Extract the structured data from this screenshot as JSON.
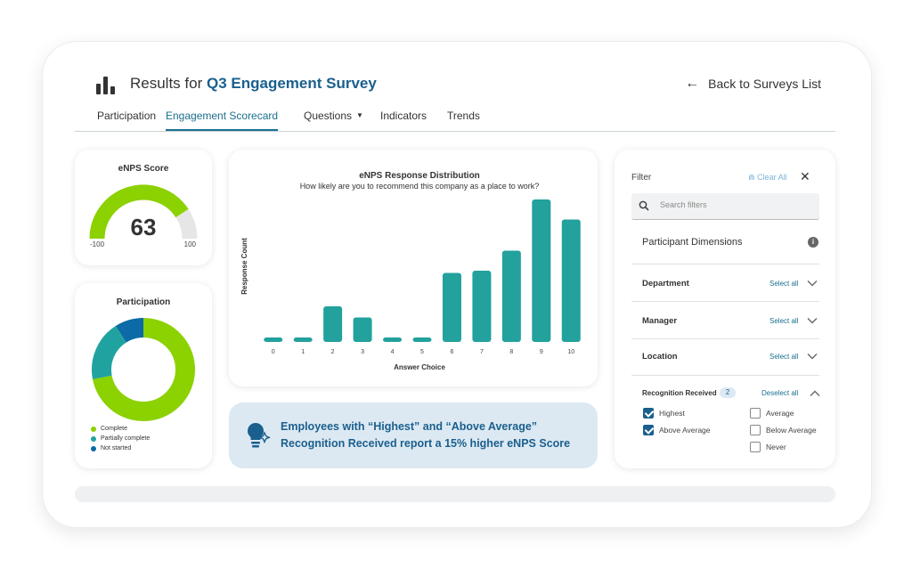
{
  "header": {
    "title_prefix": "Results for",
    "survey_name": "Q3 Engagement Survey",
    "back_label": "Back to Surveys List"
  },
  "tabs": [
    {
      "label": "Participation",
      "active": false
    },
    {
      "label": "Engagement Scorecard",
      "active": true
    },
    {
      "label": "Questions",
      "active": false
    },
    {
      "label": "Indicators",
      "active": false
    },
    {
      "label": "Trends",
      "active": false
    }
  ],
  "enps": {
    "title": "eNPS Score",
    "score": "63",
    "score_value": 63,
    "min_label": "-100",
    "max_label": "100",
    "min": -100,
    "max": 100,
    "fill_color": "#8cd100",
    "track_color": "#e6e6e6"
  },
  "participation": {
    "title": "Participation",
    "legend": [
      {
        "label": "Complete",
        "color": "#8cd100",
        "fraction": 0.72
      },
      {
        "label": "Partially complete",
        "color": "#20a3a0",
        "fraction": 0.19
      },
      {
        "label": "Not started",
        "color": "#0c6aa6",
        "fraction": 0.09
      }
    ]
  },
  "chart_data": {
    "type": "bar",
    "title": "eNPS Response Distribution",
    "subtitle": "How likely are you to recommend this company as a place to work?",
    "xlabel": "Answer Choice",
    "ylabel": "Response Count",
    "categories": [
      "0",
      "1",
      "2",
      "3",
      "4",
      "5",
      "6",
      "7",
      "8",
      "9",
      "10"
    ],
    "values": [
      1,
      1,
      8,
      5.5,
      1,
      1,
      15.5,
      16,
      20.5,
      32,
      27.5
    ],
    "ylim": [
      0,
      32
    ],
    "bar_color": "#22a19d",
    "grid": false
  },
  "insight": {
    "line1": "Employees with “Highest” and “Above Average”",
    "line2": "Recognition Received report a 15% higher eNPS Score",
    "icon": "lightbulb-sparkle-icon"
  },
  "filter": {
    "title": "Filter",
    "clear_label": "Clear All",
    "search_placeholder": "Search filters",
    "section_title": "Participant Dimensions",
    "dimensions": [
      {
        "label": "Department",
        "action": "Select all"
      },
      {
        "label": "Manager",
        "action": "Select all"
      },
      {
        "label": "Location",
        "action": "Select all"
      }
    ],
    "recognition": {
      "label": "Recognition Received",
      "count": "2",
      "action": "Deselect all",
      "options": [
        {
          "label": "Highest",
          "checked": true
        },
        {
          "label": "Average",
          "checked": false
        },
        {
          "label": "Above Average",
          "checked": true
        },
        {
          "label": "Below Average",
          "checked": false
        },
        {
          "label": "Never",
          "checked": false
        }
      ]
    }
  }
}
